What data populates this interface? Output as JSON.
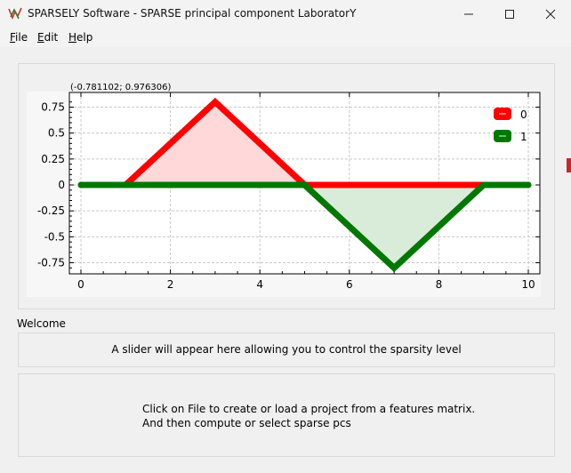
{
  "window": {
    "title": "SPARSELY Software - SPARSE principal component LaboratorY"
  },
  "menu": {
    "file": {
      "mnemonic": "F",
      "rest": "ile"
    },
    "edit": {
      "mnemonic": "E",
      "rest": "dit"
    },
    "help": {
      "mnemonic": "H",
      "rest": "elp"
    }
  },
  "plot": {
    "coordinate_readout": "(-0.781102; 0.976306)"
  },
  "chart_data": {
    "type": "area",
    "title": "",
    "xlabel": "",
    "ylabel": "",
    "xlim": [
      -0.3,
      10.2
    ],
    "ylim": [
      -0.84,
      0.86
    ],
    "x_ticks": [
      0,
      2,
      4,
      6,
      8,
      10
    ],
    "y_ticks": [
      0.75,
      0.5,
      0.25,
      0,
      -0.25,
      -0.5,
      -0.75
    ],
    "x_tick_labels": [
      "0",
      "2",
      "4",
      "6",
      "8",
      "10"
    ],
    "y_tick_labels": [
      "0.75",
      "0.5",
      "0.25",
      "0",
      "-0.25",
      "-0.5",
      "-0.75"
    ],
    "grid": true,
    "legend_position": "top-right",
    "series": [
      {
        "name": "0",
        "color": "#ff0000",
        "fill": "#ffd9d9",
        "x": [
          0,
          1,
          3,
          5,
          10
        ],
        "y": [
          0,
          0,
          0.8,
          0,
          0
        ]
      },
      {
        "name": "1",
        "color": "#007800",
        "fill": "#d9ecd9",
        "x": [
          0,
          5,
          7,
          9,
          10
        ],
        "y": [
          0,
          0,
          -0.8,
          0,
          0
        ]
      }
    ]
  },
  "status": {
    "welcome": "Welcome",
    "slider_placeholder": "A slider will appear here allowing you to control the sparsity level",
    "instruction_line1": "Click on File to create or load a project from a features matrix.",
    "instruction_line2": "And then compute or select sparse pcs"
  }
}
